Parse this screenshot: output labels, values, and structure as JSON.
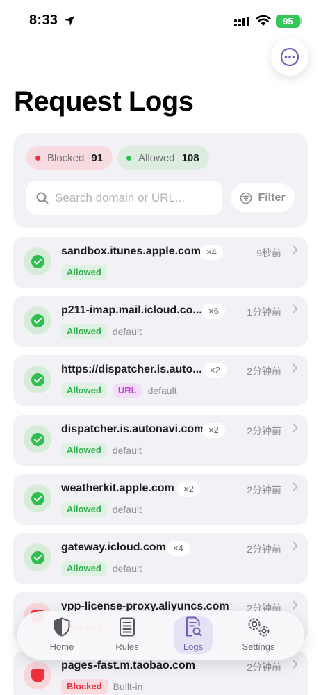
{
  "status_bar": {
    "time": "8:33",
    "battery": "95"
  },
  "page": {
    "title": "Request Logs"
  },
  "summary": {
    "blocked_label": "Blocked",
    "blocked_count": "91",
    "allowed_label": "Allowed",
    "allowed_count": "108",
    "search_placeholder": "Search domain or URL...",
    "filter_label": "Filter"
  },
  "colors": {
    "allowed": "#2fbf4f",
    "blocked": "#f0303f",
    "accent": "#6c5fb8"
  },
  "logs": [
    {
      "domain": "sandbox.itunes.apple.com",
      "count": "×4",
      "time": "9秒前",
      "status": "Allowed",
      "url_tag": "",
      "rule": ""
    },
    {
      "domain": "p211-imap.mail.icloud.co...",
      "count": "×6",
      "time": "1分钟前",
      "status": "Allowed",
      "url_tag": "",
      "rule": "default"
    },
    {
      "domain": "https://dispatcher.is.auto...",
      "count": "×2",
      "time": "2分钟前",
      "status": "Allowed",
      "url_tag": "URL",
      "rule": "default"
    },
    {
      "domain": "dispatcher.is.autonavi.com",
      "count": "×2",
      "time": "2分钟前",
      "status": "Allowed",
      "url_tag": "",
      "rule": "default"
    },
    {
      "domain": "weatherkit.apple.com",
      "count": "×2",
      "time": "2分钟前",
      "status": "Allowed",
      "url_tag": "",
      "rule": "default"
    },
    {
      "domain": "gateway.icloud.com",
      "count": "×4",
      "time": "2分钟前",
      "status": "Allowed",
      "url_tag": "",
      "rule": "default"
    },
    {
      "domain": "vpp-license-proxy.aliyuncs.com",
      "count": "",
      "time": "2分钟前",
      "status": "Blocked",
      "url_tag": "",
      "rule": ""
    },
    {
      "domain": "pages-fast.m.taobao.com",
      "count": "",
      "time": "2分钟前",
      "status": "Blocked",
      "url_tag": "",
      "rule": "Built-in"
    }
  ],
  "tabs": [
    {
      "label": "Home",
      "icon": "shield-icon"
    },
    {
      "label": "Rules",
      "icon": "list-icon"
    },
    {
      "label": "Logs",
      "icon": "document-search-icon"
    },
    {
      "label": "Settings",
      "icon": "gears-icon"
    }
  ]
}
